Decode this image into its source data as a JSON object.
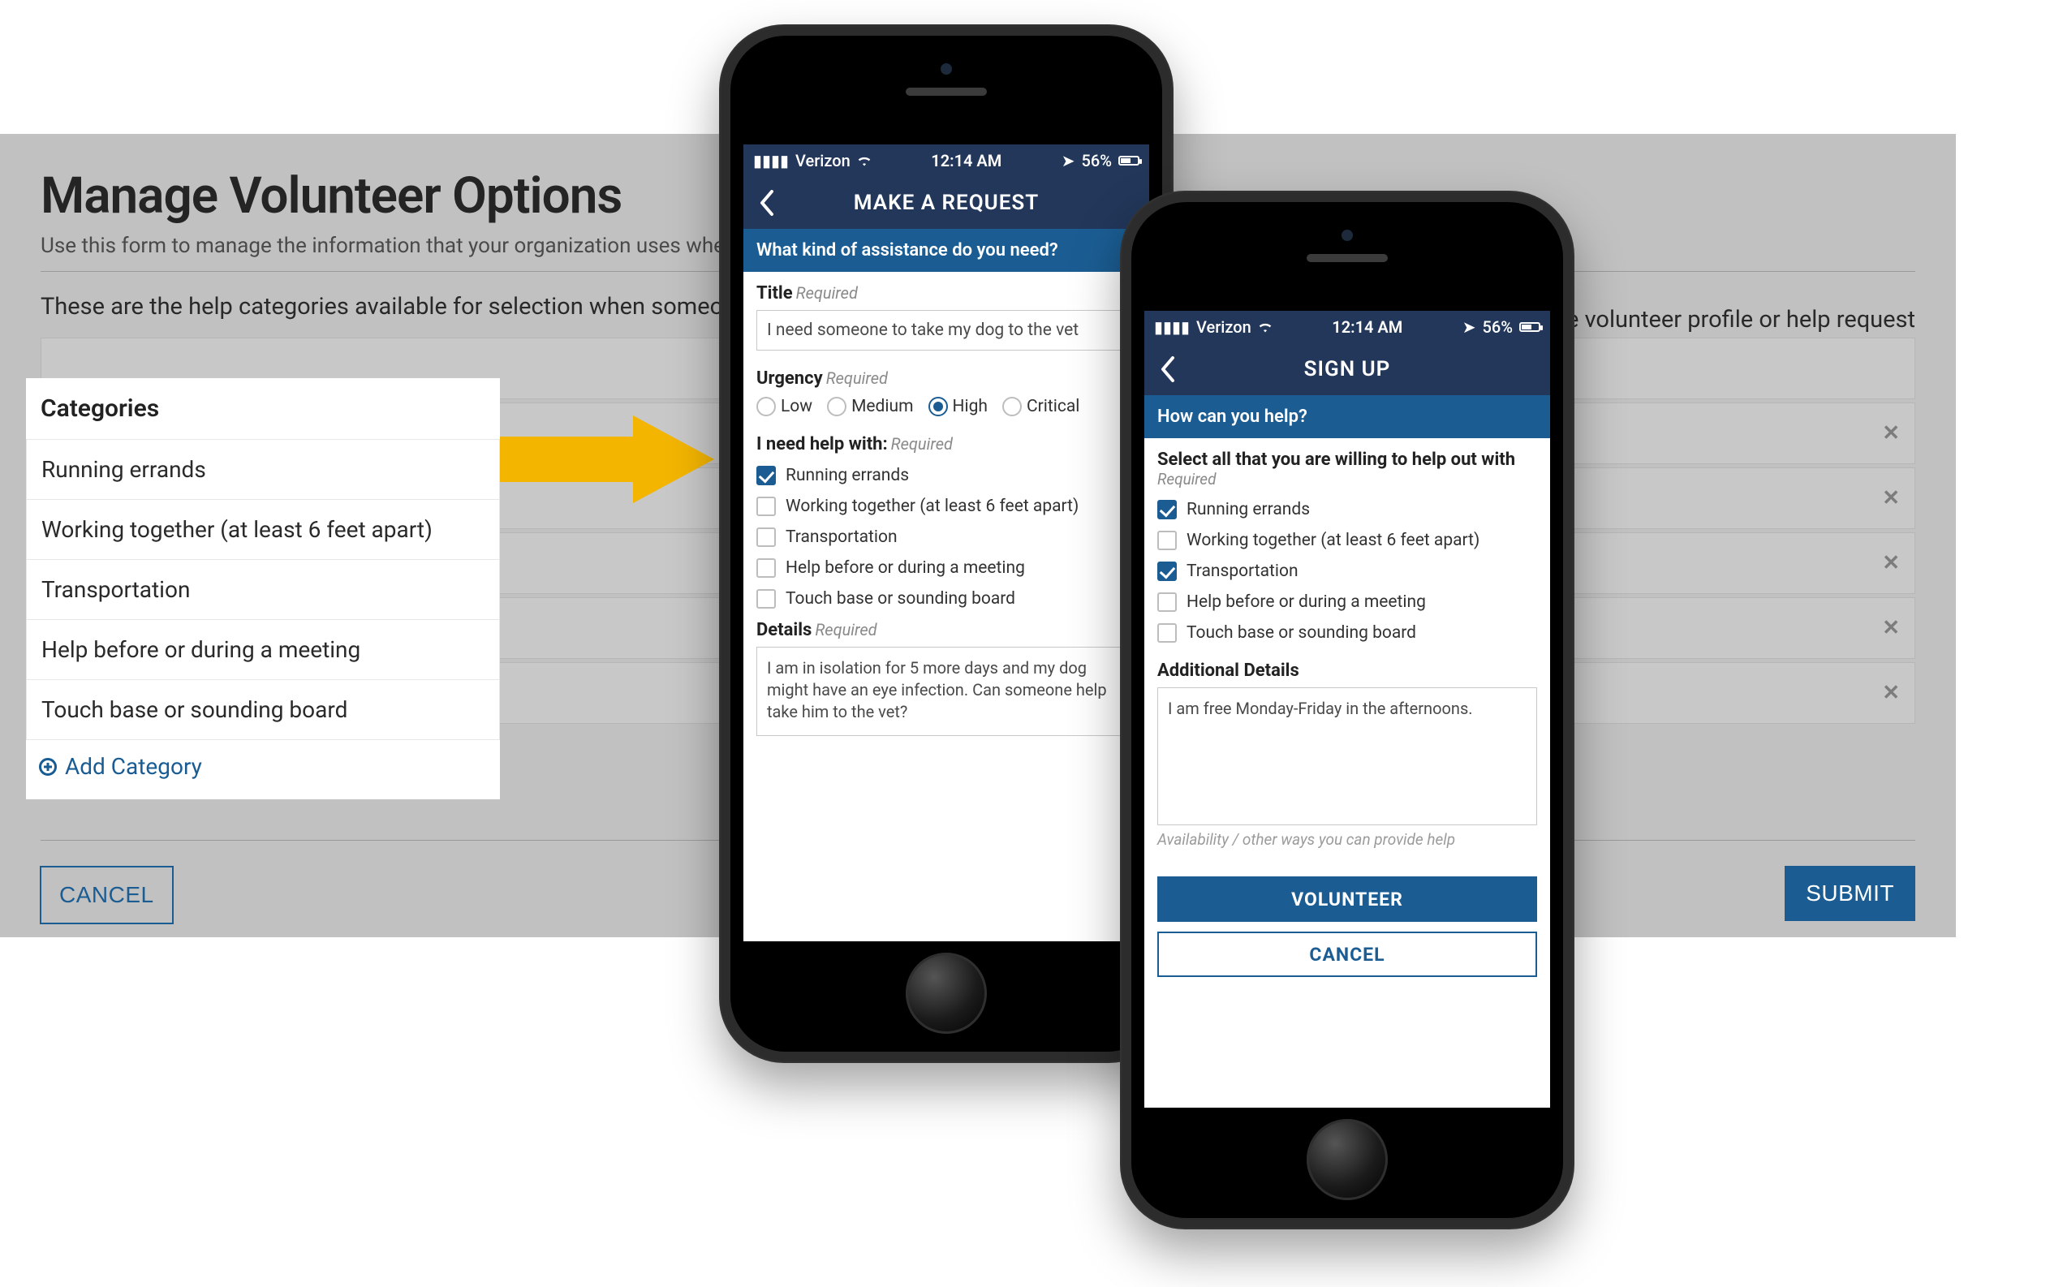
{
  "desk": {
    "title": "Manage Volunteer Options",
    "subtitle": "Use this form to manage the information that your organization uses when",
    "desc_left": "These are the help categories available for selection when someone i",
    "desc_right": "espective volunteer profile or help request record.",
    "categories_header": "Categories",
    "categories": [
      "Running errands",
      "Working together (at least 6 feet apart)",
      "Transportation",
      "Help before or during a meeting",
      "Touch base or sounding board"
    ],
    "add_category": "Add Category",
    "cancel": "CANCEL",
    "submit": "SUBMIT"
  },
  "status": {
    "carrier": "Verizon",
    "time": "12:14 AM",
    "battery": "56%"
  },
  "phone1": {
    "nav_title": "MAKE A REQUEST",
    "section": "What kind of assistance do you need?",
    "title_label": "Title",
    "required": "Required",
    "title_value": "I need someone to take my dog to the vet",
    "urgency_label": "Urgency",
    "urgency_options": [
      "Low",
      "Medium",
      "High",
      "Critical"
    ],
    "urgency_selected": "High",
    "help_with_label": "I need help with:",
    "help_items": [
      {
        "label": "Running errands",
        "checked": true
      },
      {
        "label": "Working together (at least 6 feet apart)",
        "checked": false
      },
      {
        "label": "Transportation",
        "checked": false
      },
      {
        "label": "Help before or during a meeting",
        "checked": false
      },
      {
        "label": "Touch base or sounding board",
        "checked": false
      }
    ],
    "details_label": "Details",
    "details_value": "I am in isolation for 5 more days and my dog might have an eye infection. Can someone help take him to the vet?"
  },
  "phone2": {
    "nav_title": "SIGN UP",
    "section": "How can you help?",
    "select_label": "Select all that you are willing to help out with",
    "required": "Required",
    "help_items": [
      {
        "label": "Running errands",
        "checked": true
      },
      {
        "label": "Working together (at least 6 feet apart)",
        "checked": false
      },
      {
        "label": "Transportation",
        "checked": true
      },
      {
        "label": "Help before or during a meeting",
        "checked": false
      },
      {
        "label": "Touch base or sounding board",
        "checked": false
      }
    ],
    "additional_label": "Additional Details",
    "additional_value": "I am free Monday-Friday in the afternoons.",
    "additional_placeholder": "Availability / other ways you can provide help",
    "volunteer_btn": "VOLUNTEER",
    "cancel_btn": "CANCEL"
  },
  "colors": {
    "brand_navy": "#22375a",
    "brand_blue": "#1b5d93",
    "arrow": "#f3b500"
  }
}
